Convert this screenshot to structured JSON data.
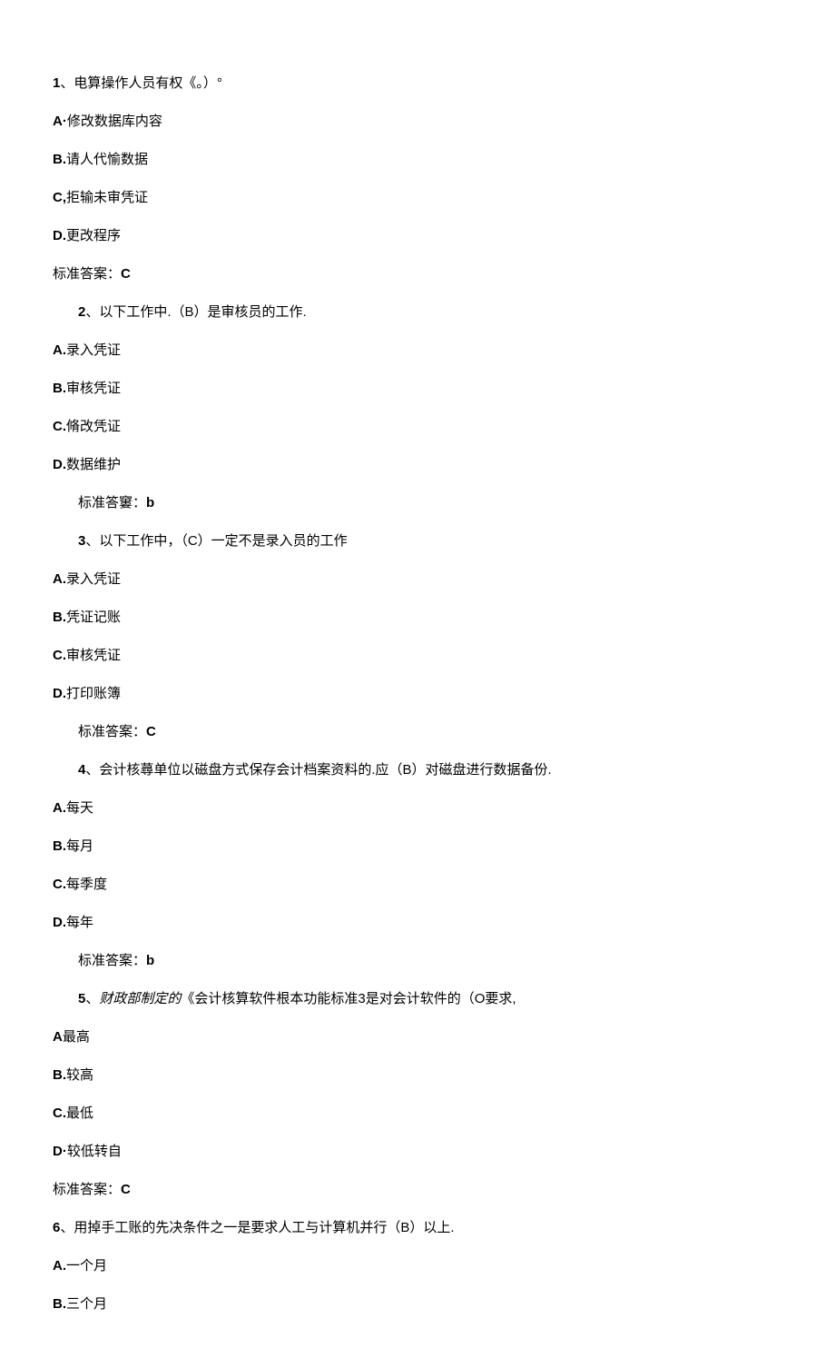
{
  "questions": [
    {
      "number": "1",
      "text": "、电算操作人员有权《。）°",
      "options": [
        {
          "label": "A·",
          "text": "修改数据库内容"
        },
        {
          "label": "B.",
          "text": "请人代愉数据"
        },
        {
          "label": "C,",
          "text": "拒输未审凭证"
        },
        {
          "label": "D.",
          "text": "更改程序"
        }
      ],
      "answer_label": "标准答案：",
      "answer_value": "C",
      "question_indent": false,
      "answer_indent": false
    },
    {
      "number": "2",
      "text": "、以下工作中.（B）是审核员的工作.",
      "options": [
        {
          "label": "A.",
          "text": "录入凭证"
        },
        {
          "label": "B.",
          "text": "审核凭证"
        },
        {
          "label": "C.",
          "text": "脩改凭证"
        },
        {
          "label": "D.",
          "text": "数据维护"
        }
      ],
      "answer_label": "标准答窶：",
      "answer_value": "b",
      "question_indent": true,
      "answer_indent": true
    },
    {
      "number": "3",
      "text": "、以下工作中，（C）一定不是录入员的工作",
      "options": [
        {
          "label": "A.",
          "text": "录入凭证"
        },
        {
          "label": "B.",
          "text": "凭证记账"
        },
        {
          "label": "C.",
          "text": "审核凭证"
        },
        {
          "label": "D.",
          "text": "打印账簿"
        }
      ],
      "answer_label": "标准答案：",
      "answer_value": "C",
      "question_indent": true,
      "answer_indent": true
    },
    {
      "number": "4",
      "text": "、会计核蕁单位以磁盘方式保存会计档案资料的.应（B）对磁盘进行数据备份.",
      "options": [
        {
          "label": "A.",
          "text": "每天"
        },
        {
          "label": "B.",
          "text": "每月"
        },
        {
          "label": "C.",
          "text": "每季度"
        },
        {
          "label": "D.",
          "text": "每年"
        }
      ],
      "answer_label": "标准答案：",
      "answer_value": "b",
      "question_indent": true,
      "answer_indent": true
    },
    {
      "number": "5",
      "text_prefix": "、",
      "text_italic": "财政部制定的",
      "text_suffix": "《会计核算软件根本功能标准3是对会计软件的（O要求,",
      "options": [
        {
          "label": "A",
          "text": "最高"
        },
        {
          "label": "B.",
          "text": "较高"
        },
        {
          "label": "C.",
          "text": "最低"
        },
        {
          "label": "D·",
          "text": "较低转自"
        }
      ],
      "answer_label": "标准答案：",
      "answer_value": "C",
      "question_indent": true,
      "answer_indent": false
    },
    {
      "number": "6",
      "text": "、用掉手工账的先决条件之一是要求人工与计算机并行（B）以上.",
      "options": [
        {
          "label": "A.",
          "text": "一个月"
        },
        {
          "label": "B.",
          "text": "三个月"
        }
      ],
      "answer_label": "",
      "answer_value": "",
      "question_indent": false,
      "answer_indent": false
    }
  ]
}
